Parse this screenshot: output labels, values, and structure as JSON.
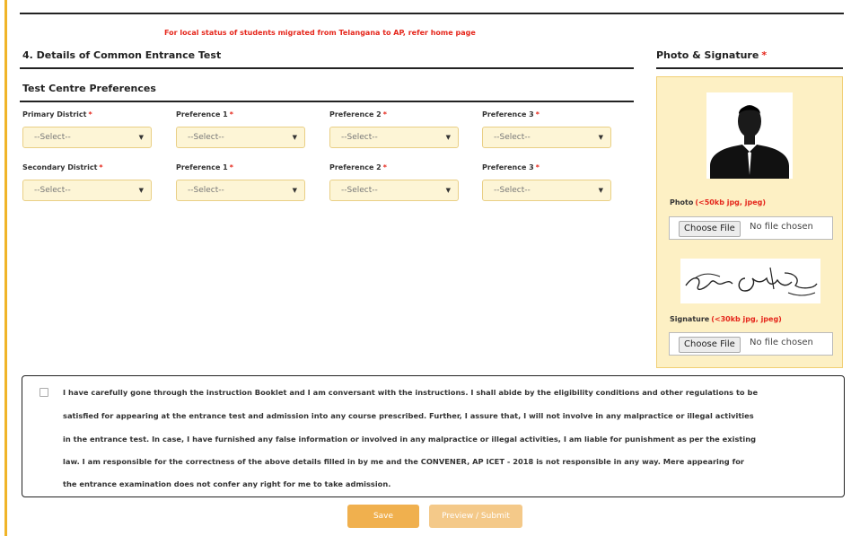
{
  "notice": "For local status of students migrated from Telangana to AP, refer home page",
  "section_title": "4. Details of Common Entrance Test",
  "subsection_title": "Test Centre Preferences",
  "required_marker": "*",
  "primary_row": {
    "labels": [
      "Primary District",
      "Preference 1",
      "Preference 2",
      "Preference 3"
    ],
    "values": [
      "--Select--",
      "--Select--",
      "--Select--",
      "--Select--"
    ]
  },
  "secondary_row": {
    "labels": [
      "Secondary District",
      "Preference 1",
      "Preference 2",
      "Preference 3"
    ],
    "values": [
      "--Select--",
      "--Select--",
      "--Select--",
      "--Select--"
    ]
  },
  "dropdown_arrow": "▼",
  "photo_signature": {
    "title": "Photo & Signature",
    "photo_label": "Photo",
    "photo_hint": "(<50kb jpg, jpeg)",
    "signature_label": "Signature",
    "signature_hint": "(<30kb jpg, jpeg)",
    "choose_file_label": "Choose File",
    "no_file_text": "No file chosen"
  },
  "declaration_lines": [
    "I have carefully gone through the instruction Booklet and I am conversant with the instructions. I shall abide by the eligibility conditions and other regulations to be",
    "satisfied for appearing at the entrance test and admission into any course prescribed. Further, I assure that, I will not involve in any malpractice or illegal activities",
    "in the entrance test. In case, I have furnished any false information or involved in any malpractice or illegal activities, I am liable for punishment as per the existing",
    "law. I am responsible for the correctness of the above details filled in by me and the CONVENER, AP ICET - 2018 is not responsible in any way. Mere appearing for",
    "the entrance examination does not confer any right for me to take admission."
  ],
  "buttons": {
    "save": "Save",
    "preview": "Preview / Submit"
  },
  "colors": {
    "accent": "#f0b429",
    "required": "#e5271c",
    "field_bg": "#fdf5d6",
    "panel_bg": "#fdf0c4"
  }
}
